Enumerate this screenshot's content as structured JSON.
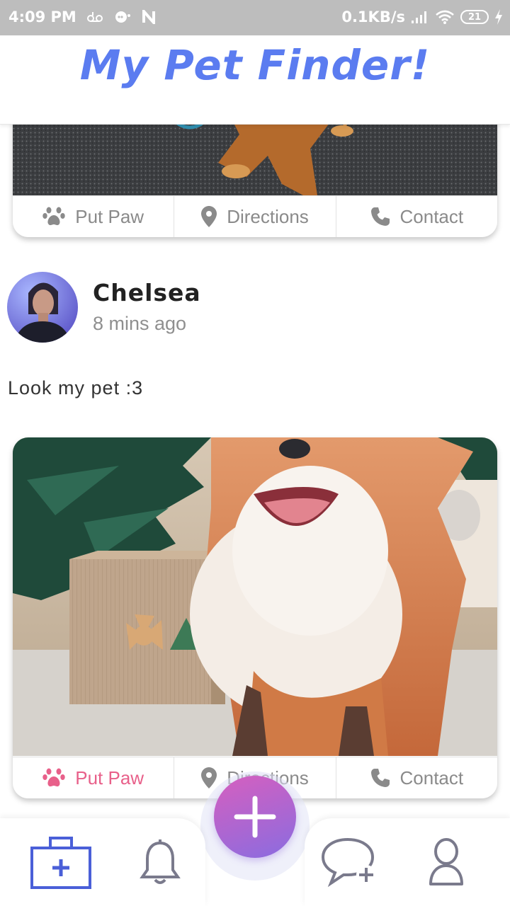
{
  "status_bar": {
    "time": "4:09 PM",
    "net_speed": "0.1KB/s",
    "battery": "21",
    "left_icons": [
      "voicemail-icon",
      "chat-bubble-icon",
      "n-notification-icon"
    ],
    "right_icons": [
      "signal-icon",
      "wifi-icon",
      "battery-icon",
      "charging-icon"
    ]
  },
  "app_bar": {
    "title": "My Pet Finder!"
  },
  "feed": {
    "top_card": {
      "actions": [
        {
          "label": "Put Paw",
          "icon": "paw-icon"
        },
        {
          "label": "Directions",
          "icon": "location-pin-icon"
        },
        {
          "label": "Contact",
          "icon": "phone-icon"
        }
      ]
    },
    "post": {
      "author": "Chelsea",
      "time_ago": "8 mins ago",
      "text": "Look my pet :3",
      "actions": [
        {
          "label": "Put Paw",
          "icon": "paw-icon",
          "active": true
        },
        {
          "label": "Directions",
          "icon": "location-pin-icon"
        },
        {
          "label": "Contact",
          "icon": "phone-icon"
        }
      ]
    }
  },
  "bottom_nav": {
    "items": [
      "medical-kit-icon",
      "bell-icon",
      "add-icon",
      "chat-plus-icon",
      "profile-icon"
    ],
    "active": "medical-kit-icon"
  },
  "colors": {
    "title": "#5b7cf0",
    "active_action": "#e8608a",
    "inactive_action": "#8a8a8a",
    "nav_active": "#4a5fd8",
    "nav_inactive": "#7a7a8c",
    "fab_gradient_start": "#d65fbf",
    "fab_gradient_end": "#8a6ce0"
  }
}
